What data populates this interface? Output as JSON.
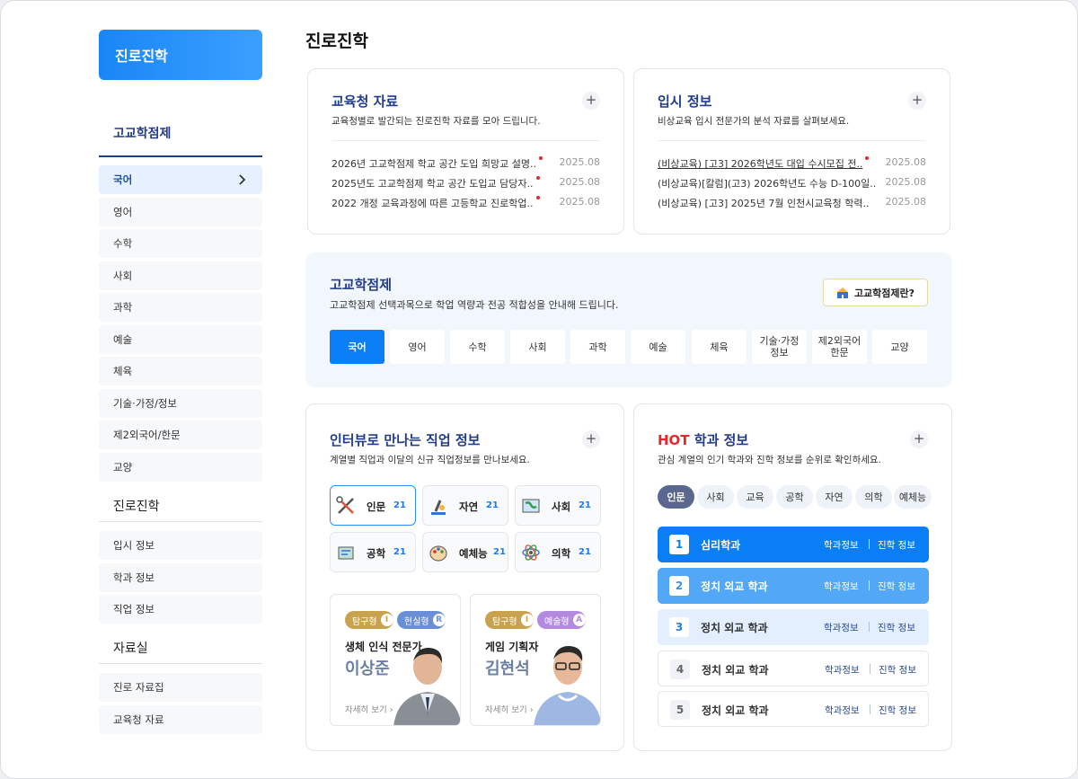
{
  "sidebar": {
    "header": "진로진학",
    "section1": "고교학점제",
    "subjects": [
      "국어",
      "영어",
      "수학",
      "사회",
      "과학",
      "예술",
      "체육",
      "기술·가정/정보",
      "제2외국어/한문",
      "교양"
    ],
    "section2": "진로진학",
    "career_items": [
      "입시 정보",
      "학과 정보",
      "직업 정보"
    ],
    "section3": "자료실",
    "resource_items": [
      "진로 자료집",
      "교육청 자료"
    ]
  },
  "page": {
    "title": "진로진학"
  },
  "edu_office": {
    "title": "교육청 자료",
    "subtitle": "교육청별로 발간되는 진로진학 자료를 모아 드립니다.",
    "plus": "+",
    "items": [
      {
        "text": "2026년 고교학점제 학교 공간 도입 희망교 설명..",
        "date": "2025.08"
      },
      {
        "text": "2025년도 고교학점제 학교 공간 도입교 담당자..",
        "date": "2025.08"
      },
      {
        "text": "2022 개정 교육과정에 따른 고등학교 진로학업..",
        "date": "2025.08"
      }
    ]
  },
  "admission": {
    "title": "입시 정보",
    "subtitle": "비상교육 입시 전문가의 분석 자료를 살펴보세요.",
    "plus": "+",
    "items": [
      {
        "text": "(비상교육) [고3] 2026학년도 대입 수시모집 전..",
        "date": "2025.08"
      },
      {
        "text": "(비상교육)[칼럼](고3) 2026학년도 수능 D-100일..",
        "date": "2025.08"
      },
      {
        "text": "(비상교육) [고3] 2025년 7월 인천시교육청 학력..",
        "date": "2025.08"
      }
    ]
  },
  "credit": {
    "title": "고교학점제",
    "subtitle": "고교학점제 선택과목으로 학업 역량과 전공 적합성을 안내해 드립니다.",
    "button": "고교학점제란?",
    "subjects": [
      "국어",
      "영어",
      "수학",
      "사회",
      "과학",
      "예술",
      "체육",
      "기술·가정\n정보",
      "제2외국어\n한문",
      "교양"
    ]
  },
  "jobs": {
    "title": "인터뷰로 만나는 직업 정보",
    "subtitle": "계열별 직업과 이달의 신규 직업정보를 만나보세요.",
    "plus": "+",
    "categories": [
      {
        "name": "인문",
        "count": "21",
        "icon": "tools-icon"
      },
      {
        "name": "자연",
        "count": "21",
        "icon": "microscope-icon"
      },
      {
        "name": "사회",
        "count": "21",
        "icon": "globe-icon"
      },
      {
        "name": "공학",
        "count": "21",
        "icon": "blueprint-icon"
      },
      {
        "name": "예체능",
        "count": "21",
        "icon": "palette-icon"
      },
      {
        "name": "의학",
        "count": "21",
        "icon": "atom-icon"
      }
    ],
    "people": [
      {
        "tag1": "탐구형",
        "tag1_letter": "I",
        "tag2": "현실형",
        "tag2_letter": "R",
        "role": "생체 인식 전문가",
        "name": "이상준",
        "more": "자세히 보기"
      },
      {
        "tag1": "탐구형",
        "tag1_letter": "I",
        "tag2": "예술형",
        "tag2_letter": "A",
        "role": "게임 기획자",
        "name": "김현석",
        "more": "자세히 보기"
      }
    ]
  },
  "hot": {
    "title_hot": "HOT",
    "title_rest": "학과 정보",
    "subtitle": "관심 계열의 인기 학과와 진학 정보를 순위로 확인하세요.",
    "plus": "+",
    "filters": [
      "인문",
      "사회",
      "교육",
      "공학",
      "자연",
      "의학",
      "예체능"
    ],
    "ranks": [
      {
        "no": "1",
        "name": "심리학과",
        "link1": "학과정보",
        "link2": "진학 정보"
      },
      {
        "no": "2",
        "name": "정치 외교 학과",
        "link1": "학과정보",
        "link2": "진학 정보"
      },
      {
        "no": "3",
        "name": "정치 외교 학과",
        "link1": "학과정보",
        "link2": "진학 정보"
      },
      {
        "no": "4",
        "name": "정치 외교 학과",
        "link1": "학과정보",
        "link2": "진학 정보"
      },
      {
        "no": "5",
        "name": "정치 외교 학과",
        "link1": "학과정보",
        "link2": "진학 정보"
      }
    ]
  },
  "colors": {
    "primary": "#0a7ff5",
    "navy": "#213c8a",
    "hot": "#e8262b"
  }
}
